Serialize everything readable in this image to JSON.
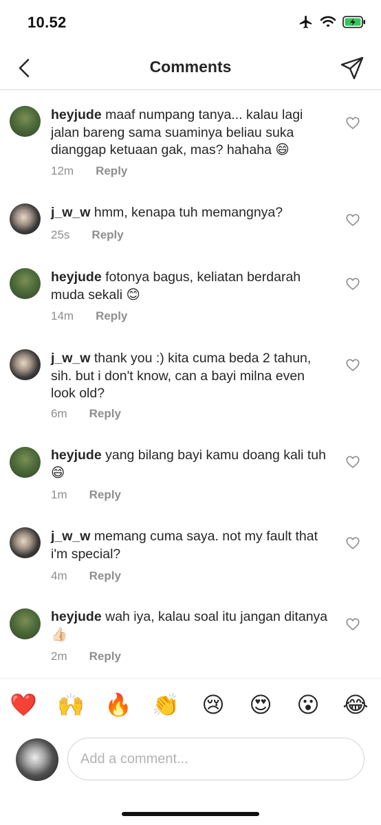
{
  "status": {
    "time": "10.52"
  },
  "header": {
    "title": "Comments"
  },
  "comments": [
    {
      "username": "heyjude",
      "text": "maaf numpang tanya... kalau lagi jalan bareng sama suaminya beliau suka dianggap ketuaan gak, mas? hahaha 😄",
      "time": "12m",
      "reply": "Reply"
    },
    {
      "username": "j_w_w",
      "text": "hmm, kenapa tuh memangnya?",
      "time": "25s",
      "reply": "Reply"
    },
    {
      "username": "heyjude",
      "text": "fotonya bagus, keliatan berdarah muda sekali 😊",
      "time": "14m",
      "reply": "Reply"
    },
    {
      "username": "j_w_w",
      "text": "thank you :) kita cuma beda 2 tahun, sih. but i don't know, can a bayi milna even look old?",
      "time": "6m",
      "reply": "Reply"
    },
    {
      "username": "heyjude",
      "text": "yang bilang bayi kamu doang kali tuh 😄",
      "time": "1m",
      "reply": "Reply"
    },
    {
      "username": "j_w_w",
      "text": "memang cuma saya. not my fault that i'm special?",
      "time": "4m",
      "reply": "Reply"
    },
    {
      "username": "heyjude",
      "text": "wah iya, kalau soal itu jangan ditanya 👍🏻",
      "time": "2m",
      "reply": "Reply"
    }
  ],
  "reactions": [
    "❤️",
    "🙌",
    "🔥",
    "👏",
    "😢",
    "😍",
    "😮",
    "😂"
  ],
  "composer": {
    "placeholder": "Add a comment..."
  },
  "colors": {
    "text": "#262626",
    "meta": "#8e8e8e",
    "divider": "#dbdbdb",
    "battery": "#34c759"
  },
  "icons": [
    "airplane-icon",
    "wifi-icon",
    "battery-charging-icon",
    "back-arrow-icon",
    "send-icon",
    "heart-outline-icon"
  ]
}
